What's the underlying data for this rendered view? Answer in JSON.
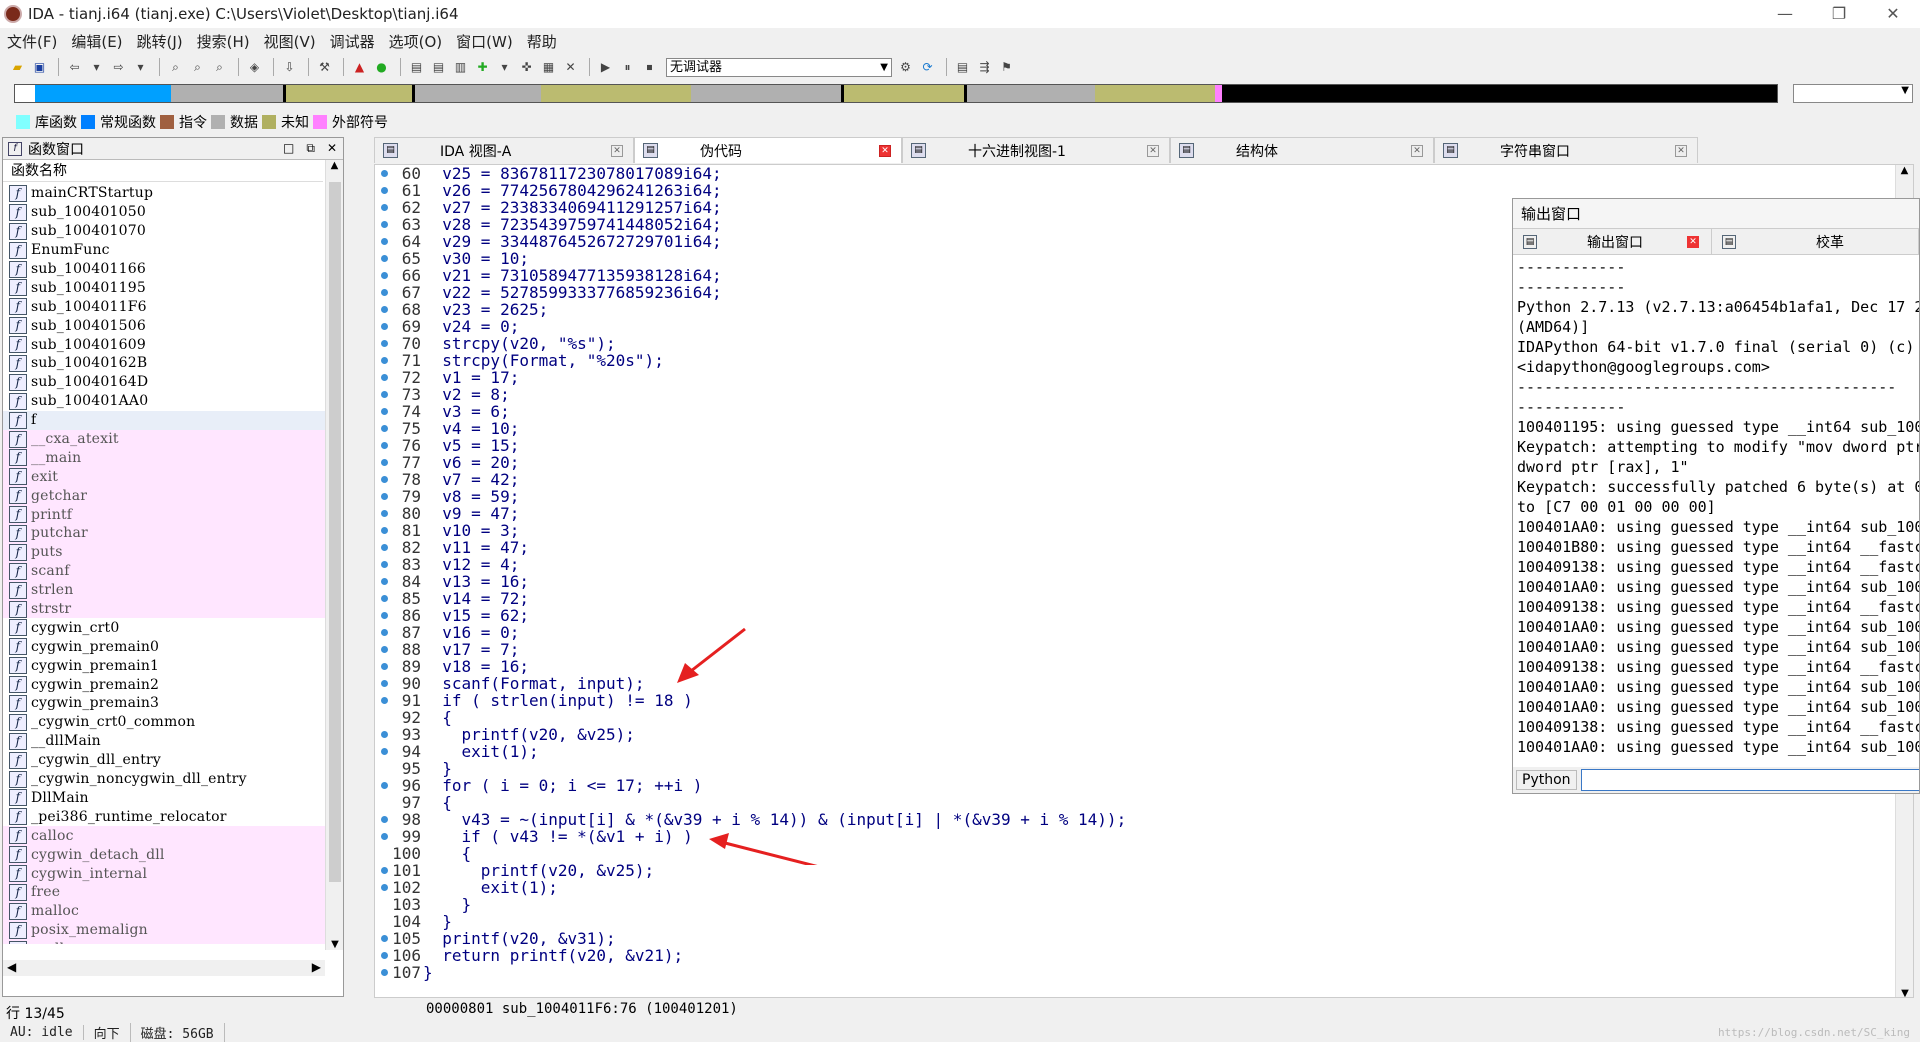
{
  "window": {
    "title": "IDA - tianj.i64 (tianj.exe) C:\\Users\\Violet\\Desktop\\tianj.i64",
    "min": "—",
    "max": "❐",
    "close": "✕"
  },
  "menu": [
    "文件(F)",
    "编辑(E)",
    "跳转(J)",
    "搜索(H)",
    "视图(V)",
    "调试器",
    "选项(O)",
    "窗口(W)",
    "帮助"
  ],
  "toolbar": {
    "debugger": "无调试器"
  },
  "navbar_colors": {
    "library": "#00a0ff",
    "regular": "#b0b0b0",
    "code": "#bbbb70",
    "external": "#ff80ff",
    "black": "#000000"
  },
  "legend": [
    {
      "label": "库函数",
      "color": "#80ffff"
    },
    {
      "label": "常规函数",
      "color": "#0080ff"
    },
    {
      "label": "指令",
      "color": "#a06040"
    },
    {
      "label": "数据",
      "color": "#b0b0b0"
    },
    {
      "label": "未知",
      "color": "#b0b060"
    },
    {
      "label": "外部符号",
      "color": "#ff80ff"
    }
  ],
  "functions_panel": {
    "title": "函数窗口",
    "column": "函数名称",
    "items": [
      {
        "name": "mainCRTStartup",
        "kind": "reg"
      },
      {
        "name": "sub_100401050",
        "kind": "reg"
      },
      {
        "name": "sub_100401070",
        "kind": "reg"
      },
      {
        "name": "EnumFunc",
        "kind": "reg"
      },
      {
        "name": "sub_100401166",
        "kind": "reg"
      },
      {
        "name": "sub_100401195",
        "kind": "reg"
      },
      {
        "name": "sub_1004011F6",
        "kind": "reg"
      },
      {
        "name": "sub_100401506",
        "kind": "reg"
      },
      {
        "name": "sub_100401609",
        "kind": "reg"
      },
      {
        "name": "sub_10040162B",
        "kind": "reg"
      },
      {
        "name": "sub_10040164D",
        "kind": "reg"
      },
      {
        "name": "sub_100401AA0",
        "kind": "reg"
      },
      {
        "name": "f",
        "kind": "sel"
      },
      {
        "name": "__cxa_atexit",
        "kind": "lib"
      },
      {
        "name": "__main",
        "kind": "lib"
      },
      {
        "name": "exit",
        "kind": "lib"
      },
      {
        "name": "getchar",
        "kind": "lib"
      },
      {
        "name": "printf",
        "kind": "lib"
      },
      {
        "name": "putchar",
        "kind": "lib"
      },
      {
        "name": "puts",
        "kind": "lib"
      },
      {
        "name": "scanf",
        "kind": "lib"
      },
      {
        "name": "strlen",
        "kind": "lib"
      },
      {
        "name": "strstr",
        "kind": "lib"
      },
      {
        "name": "cygwin_crt0",
        "kind": "reg"
      },
      {
        "name": "cygwin_premain0",
        "kind": "reg"
      },
      {
        "name": "cygwin_premain1",
        "kind": "reg"
      },
      {
        "name": "cygwin_premain2",
        "kind": "reg"
      },
      {
        "name": "cygwin_premain3",
        "kind": "reg"
      },
      {
        "name": "_cygwin_crt0_common",
        "kind": "reg"
      },
      {
        "name": "__dllMain",
        "kind": "reg"
      },
      {
        "name": "_cygwin_dll_entry",
        "kind": "reg"
      },
      {
        "name": "_cygwin_noncygwin_dll_entry",
        "kind": "reg"
      },
      {
        "name": "DllMain",
        "kind": "reg"
      },
      {
        "name": "_pei386_runtime_relocator",
        "kind": "reg"
      },
      {
        "name": "calloc",
        "kind": "lib"
      },
      {
        "name": "cygwin_detach_dll",
        "kind": "lib"
      },
      {
        "name": "cygwin_internal",
        "kind": "lib"
      },
      {
        "name": "free",
        "kind": "lib"
      },
      {
        "name": "malloc",
        "kind": "lib"
      },
      {
        "name": "posix_memalign",
        "kind": "lib"
      },
      {
        "name": "realloc",
        "kind": "lib"
      }
    ],
    "line_status": "行 13/45"
  },
  "tabs": [
    {
      "label": "IDA 视图-A",
      "active": false
    },
    {
      "label": "伪代码",
      "active": true
    },
    {
      "label": "十六进制视图-1",
      "active": false
    },
    {
      "label": "结构体",
      "active": false
    },
    {
      "label": "字符串窗口",
      "active": false
    }
  ],
  "code_lines": [
    {
      "n": "60",
      "dot": true,
      "t": "  v25 = 8367811723078017089i64;"
    },
    {
      "n": "61",
      "dot": true,
      "t": "  v26 = 7742567804296241263i64;"
    },
    {
      "n": "62",
      "dot": true,
      "t": "  v27 = 2338334069411291257i64;"
    },
    {
      "n": "63",
      "dot": true,
      "t": "  v28 = 7235439759741448052i64;"
    },
    {
      "n": "64",
      "dot": true,
      "t": "  v29 = 3344876452672729701i64;"
    },
    {
      "n": "65",
      "dot": true,
      "t": "  v30 = 10;"
    },
    {
      "n": "66",
      "dot": true,
      "t": "  v21 = 7310589477135938128i64;"
    },
    {
      "n": "67",
      "dot": true,
      "t": "  v22 = 5278599333776859236i64;"
    },
    {
      "n": "68",
      "dot": true,
      "t": "  v23 = 2625;"
    },
    {
      "n": "69",
      "dot": true,
      "t": "  v24 = 0;"
    },
    {
      "n": "70",
      "dot": true,
      "t": "  strcpy(v20, \"%s\");"
    },
    {
      "n": "71",
      "dot": true,
      "t": "  strcpy(Format, \"%20s\");"
    },
    {
      "n": "72",
      "dot": true,
      "t": "  v1 = 17;"
    },
    {
      "n": "73",
      "dot": true,
      "t": "  v2 = 8;"
    },
    {
      "n": "74",
      "dot": true,
      "t": "  v3 = 6;"
    },
    {
      "n": "75",
      "dot": true,
      "t": "  v4 = 10;"
    },
    {
      "n": "76",
      "dot": true,
      "t": "  v5 = 15;"
    },
    {
      "n": "77",
      "dot": true,
      "t": "  v6 = 20;"
    },
    {
      "n": "78",
      "dot": true,
      "t": "  v7 = 42;"
    },
    {
      "n": "79",
      "dot": true,
      "t": "  v8 = 59;"
    },
    {
      "n": "80",
      "dot": true,
      "t": "  v9 = 47;"
    },
    {
      "n": "81",
      "dot": true,
      "t": "  v10 = 3;"
    },
    {
      "n": "82",
      "dot": true,
      "t": "  v11 = 47;"
    },
    {
      "n": "83",
      "dot": true,
      "t": "  v12 = 4;"
    },
    {
      "n": "84",
      "dot": true,
      "t": "  v13 = 16;"
    },
    {
      "n": "85",
      "dot": true,
      "t": "  v14 = 72;"
    },
    {
      "n": "86",
      "dot": true,
      "t": "  v15 = 62;"
    },
    {
      "n": "87",
      "dot": true,
      "t": "  v16 = 0;"
    },
    {
      "n": "88",
      "dot": true,
      "t": "  v17 = 7;"
    },
    {
      "n": "89",
      "dot": true,
      "t": "  v18 = 16;"
    },
    {
      "n": "90",
      "dot": true,
      "t": "  scanf(Format, input);"
    },
    {
      "n": "91",
      "dot": true,
      "t": "  if ( strlen(input) != 18 )"
    },
    {
      "n": "92",
      "dot": false,
      "t": "  {"
    },
    {
      "n": "93",
      "dot": true,
      "t": "    printf(v20, &v25);"
    },
    {
      "n": "94",
      "dot": true,
      "t": "    exit(1);"
    },
    {
      "n": "95",
      "dot": false,
      "t": "  }"
    },
    {
      "n": "96",
      "dot": true,
      "t": "  for ( i = 0; i <= 17; ++i )"
    },
    {
      "n": "97",
      "dot": false,
      "t": "  {"
    },
    {
      "n": "98",
      "dot": true,
      "t": "    v43 = ~(input[i] & *(&v39 + i % 14)) & (input[i] | *(&v39 + i % 14));"
    },
    {
      "n": "99",
      "dot": true,
      "t": "    if ( v43 != *(&v1 + i) )"
    },
    {
      "n": "100",
      "dot": false,
      "t": "    {"
    },
    {
      "n": "101",
      "dot": true,
      "t": "      printf(v20, &v25);"
    },
    {
      "n": "102",
      "dot": true,
      "t": "      exit(1);"
    },
    {
      "n": "103",
      "dot": false,
      "t": "    }"
    },
    {
      "n": "104",
      "dot": false,
      "t": "  }"
    },
    {
      "n": "105",
      "dot": true,
      "t": "  printf(v20, &v31);"
    },
    {
      "n": "106",
      "dot": true,
      "t": "  return printf(v20, &v21);"
    },
    {
      "n": "107",
      "dot": true,
      "t": "}"
    }
  ],
  "editor_status": "00000801 sub_1004011F6:76 (100401201)",
  "output": {
    "title": "输出窗口",
    "tab1": "输出窗口",
    "tab2": "校革",
    "lines": [
      "------------",
      "------------",
      "Python 2.7.13 (v2.7.13:a06454b1afa1, Dec 17 2",
      "(AMD64)]",
      "IDAPython 64-bit v1.7.0 final (serial 0) (c)",
      "<idapython@googlegroups.com>",
      "------------------------------------------",
      "------------",
      "100401195: using guessed type __int64 sub_100",
      "Keypatch: attempting to modify \"mov dword ptr",
      "dword ptr [rax], 1\"",
      "Keypatch: successfully patched 6 byte(s) at 0",
      "to [C7 00 01 00 00 00]",
      "100401AA0: using guessed type __int64 sub_100",
      "100401B80: using guessed type __int64 __fastc",
      "100409138: using guessed type __int64 __fastc",
      "100401AA0: using guessed type __int64 sub_100",
      "100409138: using guessed type __int64 __fastc",
      "100401AA0: using guessed type __int64 sub_100",
      "100401AA0: using guessed type __int64 sub_100",
      "100409138: using guessed type __int64 __fastc",
      "100401AA0: using guessed type __int64 sub_100",
      "100401AA0: using guessed type __int64 sub_100",
      "100409138: using guessed type __int64 __fastc",
      "100401AA0: using guessed type __int64 sub_100"
    ],
    "input_label": "Python"
  },
  "statusbar": {
    "au": "AU:  idle",
    "dir": "向下",
    "disk": "磁盘: 56GB"
  },
  "watermark": "https://blog.csdn.net/SC_king"
}
